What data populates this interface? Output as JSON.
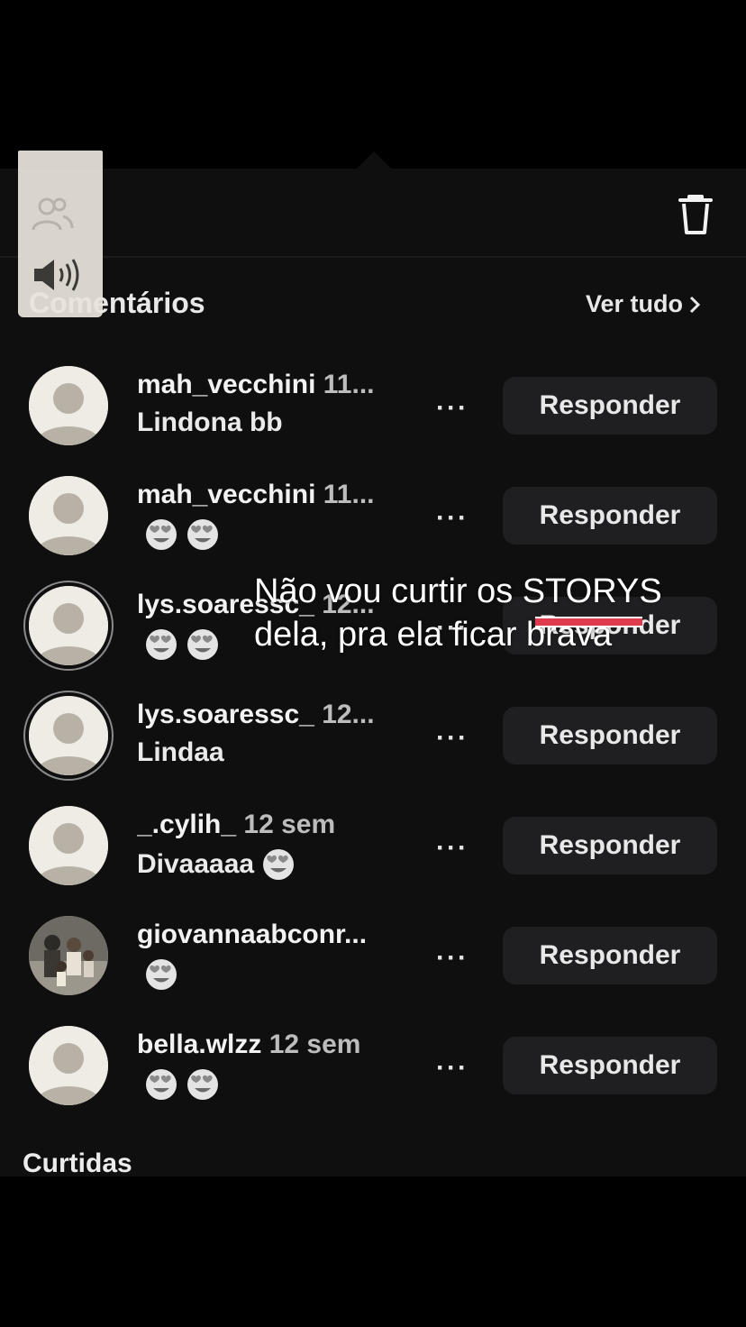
{
  "header": {
    "delete_icon": "trash-icon",
    "section_title": "Comentários",
    "see_all": "Ver tudo"
  },
  "side_panel": {
    "icons": [
      "people-icon",
      "speaker-icon"
    ]
  },
  "comments": [
    {
      "username": "mah_vecchini",
      "time": "11...",
      "text": "Lindona bb",
      "emojis": 0,
      "avatar": "default",
      "ring": false,
      "reply": "Responder",
      "more": "···"
    },
    {
      "username": "mah_vecchini",
      "time": "11...",
      "text": "",
      "emojis": 2,
      "avatar": "default",
      "ring": false,
      "reply": "Responder",
      "more": "···"
    },
    {
      "username": "lys.soaressc_",
      "time": "12...",
      "text": "",
      "emojis": 2,
      "avatar": "default",
      "ring": true,
      "reply": "Responder",
      "more": "···"
    },
    {
      "username": "lys.soaressc_",
      "time": "12...",
      "text": "Lindaa",
      "emojis": 0,
      "avatar": "default",
      "ring": true,
      "reply": "Responder",
      "more": "···"
    },
    {
      "username": "_.cylih_",
      "time": "12 sem",
      "text": "Divaaaaa",
      "emojis": 1,
      "avatar": "default",
      "ring": false,
      "reply": "Responder",
      "more": "···"
    },
    {
      "username": "giovannaabconr...",
      "time": "",
      "text": "",
      "emojis": 1,
      "avatar": "photo",
      "ring": false,
      "reply": "Responder",
      "more": "···"
    },
    {
      "username": "bella.wlzz",
      "time": "12 sem",
      "text": "",
      "emojis": 2,
      "avatar": "default",
      "ring": false,
      "reply": "Responder",
      "more": "···"
    }
  ],
  "likes_title": "Curtidas",
  "overlay_caption": {
    "line1_pre": "Não vou curtir os ",
    "line1_highlight": "STORYS",
    "line2": "dela, pra ela ficar brava"
  },
  "colors": {
    "background": "#000000",
    "sheet": "#0f0f10",
    "reply_button": "#1f1f21",
    "highlight_underline": "#e03a4e"
  }
}
